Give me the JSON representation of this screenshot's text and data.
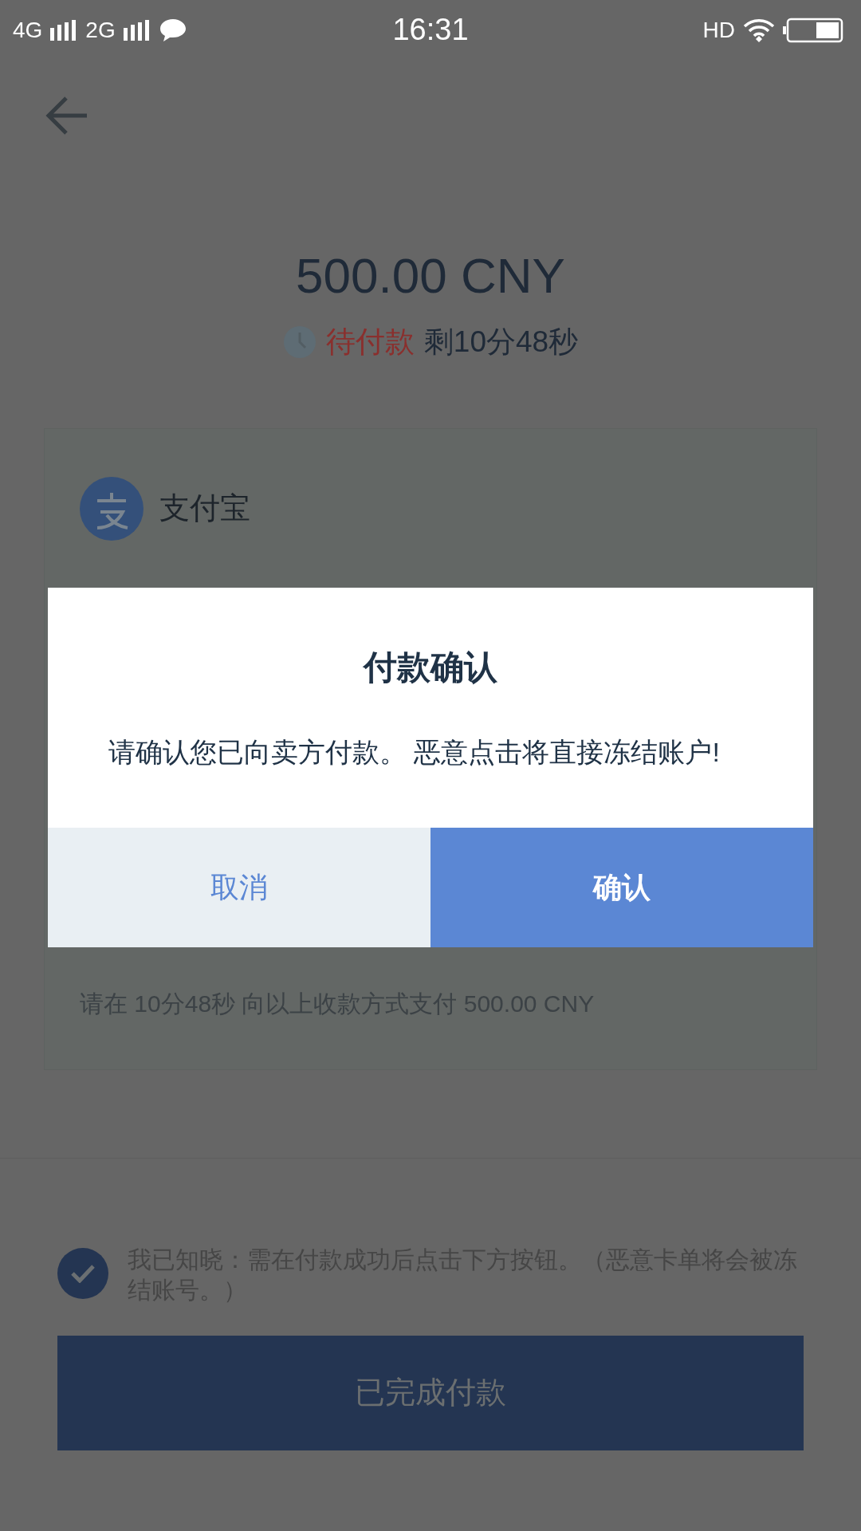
{
  "status_bar": {
    "network_1": "4G",
    "network_2": "2G",
    "time": "16:31",
    "hd": "HD"
  },
  "amount": "500.00 CNY",
  "status": {
    "label": "待付款",
    "remaining": "剩10分48秒"
  },
  "payment_method": {
    "name": "支付宝"
  },
  "instruction": "请在 10分48秒 向以上收款方式支付 500.00 CNY",
  "dialog": {
    "title": "付款确认",
    "message": "请确认您已向卖方付款。 恶意点击将直接冻结账户!",
    "buttons": [
      {
        "label": "取消",
        "kind": "cancel"
      },
      {
        "label": "确认",
        "kind": "confirm"
      }
    ]
  },
  "agreement": {
    "text": "我已知晓：需在付款成功后点击下方按钮。（恶意卡单将会被冻结账号。）",
    "checked": true
  },
  "submit_button": {
    "label": "已完成付款"
  }
}
